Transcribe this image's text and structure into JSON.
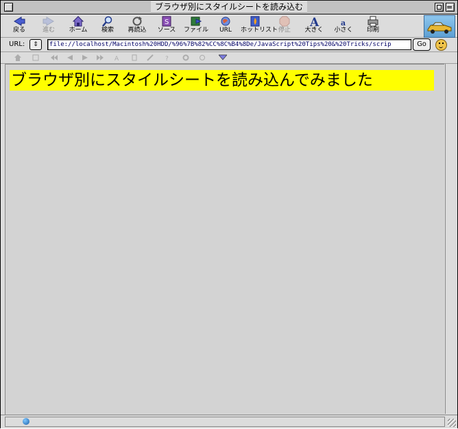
{
  "window": {
    "title": "ブラウザ別にスタイルシートを読み込む"
  },
  "toolbar": {
    "buttons": [
      {
        "label": "戻る",
        "icon": "back-arrow-icon",
        "enabled": true
      },
      {
        "label": "進む",
        "icon": "forward-arrow-icon",
        "enabled": false
      },
      {
        "label": "ホーム",
        "icon": "home-icon",
        "enabled": true
      },
      {
        "label": "検索",
        "icon": "search-icon",
        "enabled": true
      },
      {
        "label": "再読込",
        "icon": "reload-icon",
        "enabled": true
      },
      {
        "label": "ソース",
        "icon": "source-icon",
        "enabled": true
      },
      {
        "label": "ファイル",
        "icon": "file-icon",
        "enabled": true
      },
      {
        "label": "URL",
        "icon": "url-globe-icon",
        "enabled": true
      },
      {
        "label": "ホットリスト",
        "icon": "hotlist-icon",
        "enabled": true
      },
      {
        "label": "停止",
        "icon": "stop-icon",
        "enabled": false
      },
      {
        "label": "大きく",
        "icon": "font-larger-icon",
        "enabled": true
      },
      {
        "label": "小さく",
        "icon": "font-smaller-icon",
        "enabled": true
      },
      {
        "label": "印刷",
        "icon": "print-icon",
        "enabled": true
      }
    ]
  },
  "urlbar": {
    "label": "URL:",
    "value": "file://localhost/Macintosh%20HDD/%96%7B%82%CC%8C%B4%8De/JavaScript%20Tips%20&%20Tricks/scrip",
    "go_label": "Go"
  },
  "content": {
    "heading": "ブラウザ別にスタイルシートを読み込んでみました"
  },
  "colors": {
    "heading_background": "#ffff00",
    "content_background": "#d3d3d3"
  }
}
